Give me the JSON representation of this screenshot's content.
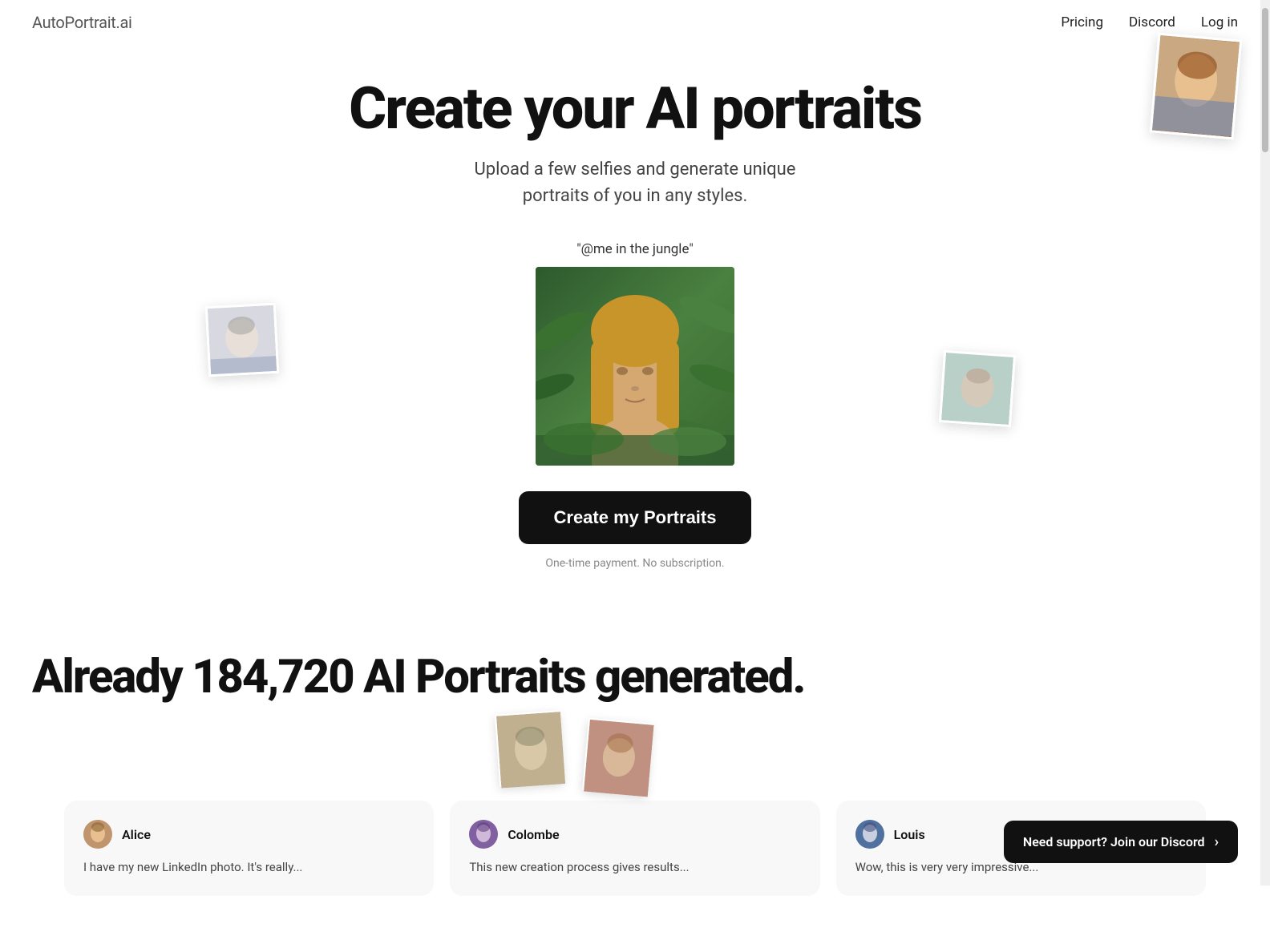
{
  "nav": {
    "logo": "AutoPortrait",
    "logo_suffix": ".ai",
    "links": [
      {
        "label": "Pricing",
        "id": "pricing"
      },
      {
        "label": "Discord",
        "id": "discord"
      },
      {
        "label": "Log in",
        "id": "login"
      }
    ]
  },
  "hero": {
    "title": "Create your AI portraits",
    "subtitle_line1": "Upload a few selfies and generate unique",
    "subtitle_line2": "portraits of you in any styles.",
    "prompt_label": "\"@me in the jungle\"",
    "cta_button": "Create my Portraits",
    "cta_subtext": "One-time payment. No subscription."
  },
  "stats": {
    "title": "Already 184,720 AI Portraits generated."
  },
  "testimonials": [
    {
      "name": "Alice",
      "avatar_color": "#c0956e",
      "text": "I have my new LinkedIn photo. It's really..."
    },
    {
      "name": "Colombe",
      "avatar_color": "#8060a0",
      "text": "This new creation process gives results..."
    },
    {
      "name": "Louis",
      "avatar_color": "#5070a0",
      "text": "Wow, this is very very impressive..."
    }
  ],
  "discord_banner": {
    "text": "Need support? Join our Discord",
    "chevron": "›"
  }
}
